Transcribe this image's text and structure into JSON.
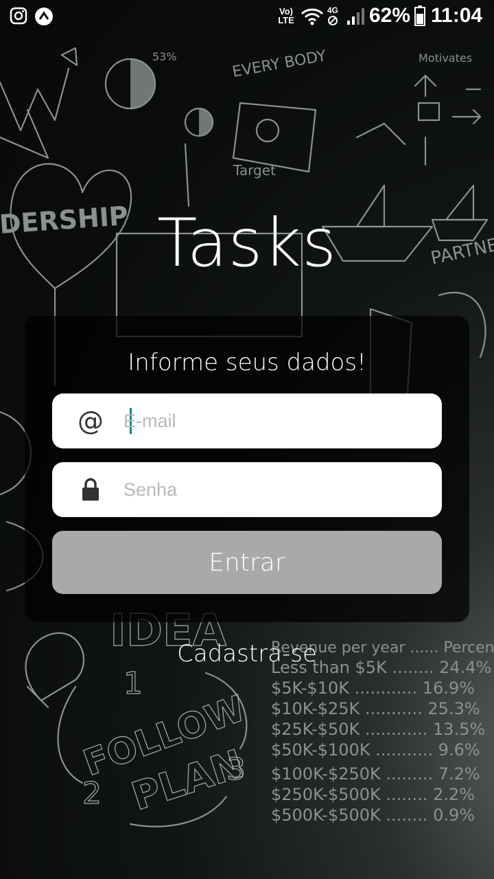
{
  "status_bar": {
    "left_icons": [
      "instagram-icon",
      "app-notification-icon"
    ],
    "network_label_top": "Vo)",
    "network_label_bottom": "LTE",
    "network_type": "4G",
    "battery_percent": "62%",
    "time": "11:04"
  },
  "app": {
    "title": "Tasks"
  },
  "login": {
    "heading": "Informe seus dados!",
    "email": {
      "icon": "at-sign-icon",
      "icon_glyph": "@",
      "placeholder": "E-mail",
      "value": ""
    },
    "password": {
      "icon": "lock-icon",
      "placeholder": "Senha",
      "value": ""
    },
    "submit_label": "Entrar",
    "register_label": "Cadastra-se"
  },
  "colors": {
    "card_background": "rgba(0,0,0,0.72)",
    "input_background": "#ffffff",
    "button_background": "#a9a9a9",
    "cursor_color": "#138477",
    "text_primary": "#ffffff"
  }
}
